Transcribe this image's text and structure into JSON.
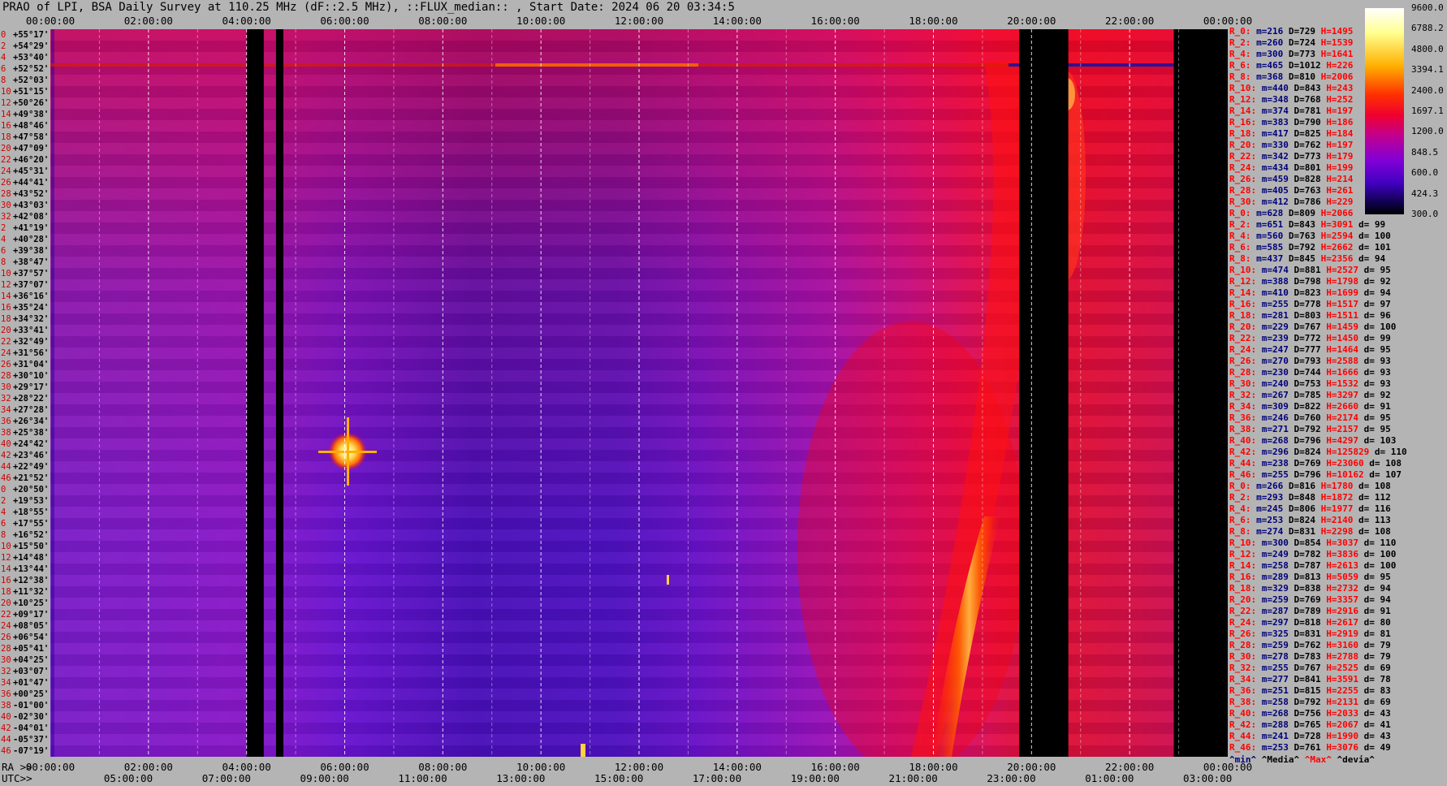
{
  "title": "PRAO of LPI, BSA Daily Survey at 110.25 MHz (dF::2.5 MHz), ::FLUX_median:: , Start Date: 2024 06 20 03:34:5",
  "axis_labels": {
    "ra_prefix": "RA >>",
    "utc_prefix": "UTC>>"
  },
  "top_ticks": [
    "00:00:00",
    "02:00:00",
    "04:00:00",
    "06:00:00",
    "08:00:00",
    "10:00:00",
    "12:00:00",
    "14:00:00",
    "16:00:00",
    "18:00:00",
    "20:00:00",
    "22:00:00",
    "00:00:00"
  ],
  "ra_ticks": [
    "00:00:00",
    "02:00:00",
    "04:00:00",
    "06:00:00",
    "08:00:00",
    "10:00:00",
    "12:00:00",
    "14:00:00",
    "16:00:00",
    "18:00:00",
    "20:00:00",
    "22:00:00",
    "00:00:00"
  ],
  "utc_ticks": [
    "05:00:00",
    "07:00:00",
    "09:00:00",
    "11:00:00",
    "13:00:00",
    "15:00:00",
    "17:00:00",
    "19:00:00",
    "21:00:00",
    "23:00:00",
    "01:00:00",
    "03:00:00"
  ],
  "declinations": [
    {
      "i": "0",
      "d": "+55°17'"
    },
    {
      "i": "2",
      "d": "+54°29'"
    },
    {
      "i": "4",
      "d": "+53°40'"
    },
    {
      "i": "6",
      "d": "+52°52'"
    },
    {
      "i": "8",
      "d": "+52°03'"
    },
    {
      "i": "10",
      "d": "+51°15'"
    },
    {
      "i": "12",
      "d": "+50°26'"
    },
    {
      "i": "14",
      "d": "+49°38'"
    },
    {
      "i": "16",
      "d": "+48°46'"
    },
    {
      "i": "18",
      "d": "+47°58'"
    },
    {
      "i": "20",
      "d": "+47°09'"
    },
    {
      "i": "22",
      "d": "+46°20'"
    },
    {
      "i": "24",
      "d": "+45°31'"
    },
    {
      "i": "26",
      "d": "+44°41'"
    },
    {
      "i": "28",
      "d": "+43°52'"
    },
    {
      "i": "30",
      "d": "+43°03'"
    },
    {
      "i": "32",
      "d": "+42°08'"
    },
    {
      "i": "2",
      "d": "+41°19'"
    },
    {
      "i": "4",
      "d": "+40°28'"
    },
    {
      "i": "6",
      "d": "+39°38'"
    },
    {
      "i": "8",
      "d": "+38°47'"
    },
    {
      "i": "10",
      "d": "+37°57'"
    },
    {
      "i": "12",
      "d": "+37°07'"
    },
    {
      "i": "14",
      "d": "+36°16'"
    },
    {
      "i": "16",
      "d": "+35°24'"
    },
    {
      "i": "18",
      "d": "+34°32'"
    },
    {
      "i": "20",
      "d": "+33°41'"
    },
    {
      "i": "22",
      "d": "+32°49'"
    },
    {
      "i": "24",
      "d": "+31°56'"
    },
    {
      "i": "26",
      "d": "+31°04'"
    },
    {
      "i": "28",
      "d": "+30°10'"
    },
    {
      "i": "30",
      "d": "+29°17'"
    },
    {
      "i": "32",
      "d": "+28°22'"
    },
    {
      "i": "34",
      "d": "+27°28'"
    },
    {
      "i": "36",
      "d": "+26°34'"
    },
    {
      "i": "38",
      "d": "+25°38'"
    },
    {
      "i": "40",
      "d": "+24°42'"
    },
    {
      "i": "42",
      "d": "+23°46'"
    },
    {
      "i": "44",
      "d": "+22°49'"
    },
    {
      "i": "46",
      "d": "+21°52'"
    },
    {
      "i": "0",
      "d": "+20°50'"
    },
    {
      "i": "2",
      "d": "+19°53'"
    },
    {
      "i": "4",
      "d": "+18°55'"
    },
    {
      "i": "6",
      "d": "+17°55'"
    },
    {
      "i": "8",
      "d": "+16°52'"
    },
    {
      "i": "10",
      "d": "+15°50'"
    },
    {
      "i": "12",
      "d": "+14°48'"
    },
    {
      "i": "14",
      "d": "+13°44'"
    },
    {
      "i": "16",
      "d": "+12°38'"
    },
    {
      "i": "18",
      "d": "+11°32'"
    },
    {
      "i": "20",
      "d": "+10°25'"
    },
    {
      "i": "22",
      "d": "+09°17'"
    },
    {
      "i": "24",
      "d": "+08°05'"
    },
    {
      "i": "26",
      "d": "+06°54'"
    },
    {
      "i": "28",
      "d": "+05°41'"
    },
    {
      "i": "30",
      "d": "+04°25'"
    },
    {
      "i": "32",
      "d": "+03°07'"
    },
    {
      "i": "34",
      "d": "+01°47'"
    },
    {
      "i": "36",
      "d": "+00°25'"
    },
    {
      "i": "38",
      "d": "-01°00'"
    },
    {
      "i": "40",
      "d": "-02°30'"
    },
    {
      "i": "42",
      "d": "-04°01'"
    },
    {
      "i": "44",
      "d": "-05°37'"
    },
    {
      "i": "46",
      "d": "-07°19'"
    }
  ],
  "colorbar_labels": [
    "9600.0",
    "6788.2",
    "4800.0",
    "3394.1",
    "2400.0",
    "1697.1",
    "1200.0",
    "848.5",
    "600.0",
    "424.3",
    "300.0"
  ],
  "stats": [
    {
      "r": "R_0:",
      "m": "m=216",
      "d": "D=729",
      "h": "H=1495",
      "dd": ""
    },
    {
      "r": "R_2:",
      "m": "m=260",
      "d": "D=724",
      "h": "H=1539",
      "dd": ""
    },
    {
      "r": "R_4:",
      "m": "m=300",
      "d": "D=773",
      "h": "H=1641",
      "dd": ""
    },
    {
      "r": "R_6:",
      "m": "m=465",
      "d": "D=1012",
      "h": "H=226",
      "dd": ""
    },
    {
      "r": "R_8:",
      "m": "m=368",
      "d": "D=810",
      "h": "H=2006",
      "dd": ""
    },
    {
      "r": "R_10:",
      "m": "m=440",
      "d": "D=843",
      "h": "H=243",
      "dd": ""
    },
    {
      "r": "R_12:",
      "m": "m=348",
      "d": "D=768",
      "h": "H=252",
      "dd": ""
    },
    {
      "r": "R_14:",
      "m": "m=374",
      "d": "D=781",
      "h": "H=197",
      "dd": ""
    },
    {
      "r": "R_16:",
      "m": "m=383",
      "d": "D=790",
      "h": "H=186",
      "dd": ""
    },
    {
      "r": "R_18:",
      "m": "m=417",
      "d": "D=825",
      "h": "H=184",
      "dd": ""
    },
    {
      "r": "R_20:",
      "m": "m=330",
      "d": "D=762",
      "h": "H=197",
      "dd": ""
    },
    {
      "r": "R_22:",
      "m": "m=342",
      "d": "D=773",
      "h": "H=179",
      "dd": ""
    },
    {
      "r": "R_24:",
      "m": "m=434",
      "d": "D=801",
      "h": "H=199",
      "dd": ""
    },
    {
      "r": "R_26:",
      "m": "m=459",
      "d": "D=828",
      "h": "H=214",
      "dd": ""
    },
    {
      "r": "R_28:",
      "m": "m=405",
      "d": "D=763",
      "h": "H=261",
      "dd": ""
    },
    {
      "r": "R_30:",
      "m": "m=412",
      "d": "D=786",
      "h": "H=229",
      "dd": ""
    },
    {
      "r": "R_0:",
      "m": "m=628",
      "d": "D=809",
      "h": "H=2066",
      "dd": ""
    },
    {
      "r": "R_2:",
      "m": "m=651",
      "d": "D=843",
      "h": "H=3091",
      "dd": "d= 99"
    },
    {
      "r": "R_4:",
      "m": "m=560",
      "d": "D=763",
      "h": "H=2594",
      "dd": "d= 100"
    },
    {
      "r": "R_6:",
      "m": "m=585",
      "d": "D=792",
      "h": "H=2662",
      "dd": "d= 101"
    },
    {
      "r": "R_8:",
      "m": "m=437",
      "d": "D=845",
      "h": "H=2356",
      "dd": "d= 94"
    },
    {
      "r": "R_10:",
      "m": "m=474",
      "d": "D=881",
      "h": "H=2527",
      "dd": "d= 95"
    },
    {
      "r": "R_12:",
      "m": "m=388",
      "d": "D=798",
      "h": "H=1798",
      "dd": "d= 92"
    },
    {
      "r": "R_14:",
      "m": "m=410",
      "d": "D=823",
      "h": "H=1699",
      "dd": "d= 94"
    },
    {
      "r": "R_16:",
      "m": "m=255",
      "d": "D=778",
      "h": "H=1517",
      "dd": "d= 97"
    },
    {
      "r": "R_18:",
      "m": "m=281",
      "d": "D=803",
      "h": "H=1511",
      "dd": "d= 96"
    },
    {
      "r": "R_20:",
      "m": "m=229",
      "d": "D=767",
      "h": "H=1459",
      "dd": "d= 100"
    },
    {
      "r": "R_22:",
      "m": "m=239",
      "d": "D=772",
      "h": "H=1450",
      "dd": "d= 99"
    },
    {
      "r": "R_24:",
      "m": "m=247",
      "d": "D=777",
      "h": "H=1464",
      "dd": "d= 95"
    },
    {
      "r": "R_26:",
      "m": "m=270",
      "d": "D=793",
      "h": "H=2588",
      "dd": "d= 93"
    },
    {
      "r": "R_28:",
      "m": "m=230",
      "d": "D=744",
      "h": "H=1666",
      "dd": "d= 93"
    },
    {
      "r": "R_30:",
      "m": "m=240",
      "d": "D=753",
      "h": "H=1532",
      "dd": "d= 93"
    },
    {
      "r": "R_32:",
      "m": "m=267",
      "d": "D=785",
      "h": "H=3297",
      "dd": "d= 92"
    },
    {
      "r": "R_34:",
      "m": "m=309",
      "d": "D=822",
      "h": "H=2660",
      "dd": "d= 91"
    },
    {
      "r": "R_36:",
      "m": "m=246",
      "d": "D=760",
      "h": "H=2174",
      "dd": "d= 95"
    },
    {
      "r": "R_38:",
      "m": "m=271",
      "d": "D=792",
      "h": "H=2157",
      "dd": "d= 95"
    },
    {
      "r": "R_40:",
      "m": "m=268",
      "d": "D=796",
      "h": "H=4297",
      "dd": "d= 103"
    },
    {
      "r": "R_42:",
      "m": "m=296",
      "d": "D=824",
      "h": "H=125829",
      "dd": "d= 110"
    },
    {
      "r": "R_44:",
      "m": "m=238",
      "d": "D=769",
      "h": "H=23060",
      "dd": "d= 108"
    },
    {
      "r": "R_46:",
      "m": "m=255",
      "d": "D=796",
      "h": "H=10162",
      "dd": "d= 107"
    },
    {
      "r": "R_0:",
      "m": "m=266",
      "d": "D=816",
      "h": "H=1780",
      "dd": "d= 108"
    },
    {
      "r": "R_2:",
      "m": "m=293",
      "d": "D=848",
      "h": "H=1872",
      "dd": "d= 112"
    },
    {
      "r": "R_4:",
      "m": "m=245",
      "d": "D=806",
      "h": "H=1977",
      "dd": "d= 116"
    },
    {
      "r": "R_6:",
      "m": "m=253",
      "d": "D=824",
      "h": "H=2140",
      "dd": "d= 113"
    },
    {
      "r": "R_8:",
      "m": "m=274",
      "d": "D=831",
      "h": "H=2298",
      "dd": "d= 108"
    },
    {
      "r": "R_10:",
      "m": "m=300",
      "d": "D=854",
      "h": "H=3037",
      "dd": "d= 110"
    },
    {
      "r": "R_12:",
      "m": "m=249",
      "d": "D=782",
      "h": "H=3836",
      "dd": "d= 100"
    },
    {
      "r": "R_14:",
      "m": "m=258",
      "d": "D=787",
      "h": "H=2613",
      "dd": "d= 100"
    },
    {
      "r": "R_16:",
      "m": "m=289",
      "d": "D=813",
      "h": "H=5059",
      "dd": "d= 95"
    },
    {
      "r": "R_18:",
      "m": "m=329",
      "d": "D=838",
      "h": "H=2732",
      "dd": "d= 94"
    },
    {
      "r": "R_20:",
      "m": "m=259",
      "d": "D=769",
      "h": "H=3357",
      "dd": "d= 94"
    },
    {
      "r": "R_22:",
      "m": "m=287",
      "d": "D=789",
      "h": "H=2916",
      "dd": "d= 91"
    },
    {
      "r": "R_24:",
      "m": "m=297",
      "d": "D=818",
      "h": "H=2617",
      "dd": "d= 80"
    },
    {
      "r": "R_26:",
      "m": "m=325",
      "d": "D=831",
      "h": "H=2919",
      "dd": "d= 81"
    },
    {
      "r": "R_28:",
      "m": "m=259",
      "d": "D=762",
      "h": "H=3160",
      "dd": "d= 79"
    },
    {
      "r": "R_30:",
      "m": "m=278",
      "d": "D=783",
      "h": "H=2788",
      "dd": "d= 79"
    },
    {
      "r": "R_32:",
      "m": "m=255",
      "d": "D=767",
      "h": "H=2525",
      "dd": "d= 69"
    },
    {
      "r": "R_34:",
      "m": "m=277",
      "d": "D=841",
      "h": "H=3591",
      "dd": "d= 78"
    },
    {
      "r": "R_36:",
      "m": "m=251",
      "d": "D=815",
      "h": "H=2255",
      "dd": "d= 83"
    },
    {
      "r": "R_38:",
      "m": "m=258",
      "d": "D=792",
      "h": "H=2131",
      "dd": "d= 69"
    },
    {
      "r": "R_40:",
      "m": "m=268",
      "d": "D=756",
      "h": "H=2033",
      "dd": "d= 43"
    },
    {
      "r": "R_42:",
      "m": "m=288",
      "d": "D=765",
      "h": "H=2067",
      "dd": "d= 41"
    },
    {
      "r": "R_44:",
      "m": "m=241",
      "d": "D=728",
      "h": "H=1990",
      "dd": "d= 43"
    },
    {
      "r": "R_46:",
      "m": "m=253",
      "d": "D=761",
      "h": "H=3076",
      "dd": "d= 49"
    }
  ],
  "stats_footer": {
    "min": "^min^",
    "median": "^Media^",
    "max": "^Max^",
    "dev": "^devia^"
  },
  "chart_data": {
    "type": "heatmap",
    "title": "PRAO of LPI, BSA Daily Survey at 110.25 MHz (dF::2.5 MHz), ::FLUX_median:: , Start Date: 2024 06 20 03:34:5",
    "x_axis": "RA (sidereal time), 00:00:00 to 00:00:00 (24 h)",
    "y_axis": "Declination, +55°17' to -07°19' (64 beams)",
    "colorscale": {
      "min": 300.0,
      "max": 9600.0,
      "scale": "log",
      "ticks": [
        9600.0,
        6788.2,
        4800.0,
        3394.1,
        2400.0,
        1697.1,
        1200.0,
        848.5,
        600.0,
        424.3,
        300.0
      ]
    },
    "gaps_ra_hours": [
      [
        4.0,
        4.35
      ],
      [
        4.6,
        4.75
      ],
      [
        19.75,
        20.75
      ],
      [
        22.9,
        24.0
      ]
    ],
    "features": [
      {
        "ra_h": 6.0,
        "dec": "+23°46'",
        "note": "bright point source (Cas A-like burst)"
      },
      {
        "ra_h": 20.8,
        "dec_range": [
          "+51°15'",
          "+40°28'"
        ],
        "note": "Cygnus region, bright"
      },
      {
        "ra_h_range": [
          18.5,
          20.5
        ],
        "dec_range": [
          "+20°50'",
          "-07°19'"
        ],
        "note": "galactic plane ridge, bright"
      }
    ],
    "grid": true
  }
}
